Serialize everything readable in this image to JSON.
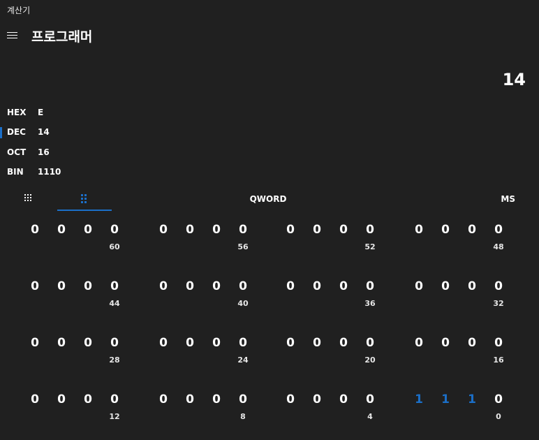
{
  "window": {
    "title": "계산기"
  },
  "header": {
    "menu_icon": "hamburger-icon",
    "mode_title": "프로그래머"
  },
  "display": {
    "value": "14"
  },
  "radix": [
    {
      "name": "HEX",
      "value": "E",
      "active": false
    },
    {
      "name": "DEC",
      "value": "14",
      "active": true
    },
    {
      "name": "OCT",
      "value": "16",
      "active": false
    },
    {
      "name": "BIN",
      "value": "1110",
      "active": false
    }
  ],
  "toolbar": {
    "keypad_icon": "keypad-grid-icon",
    "bit_toggle_icon": "bit-toggle-icon",
    "word_size": "QWORD",
    "memory": "MS"
  },
  "bitpad": {
    "rows": [
      {
        "bits": [
          "0",
          "0",
          "0",
          "0",
          "0",
          "0",
          "0",
          "0",
          "0",
          "0",
          "0",
          "0",
          "0",
          "0",
          "0",
          "0"
        ],
        "labels": [
          "60",
          "56",
          "52",
          "48"
        ]
      },
      {
        "bits": [
          "0",
          "0",
          "0",
          "0",
          "0",
          "0",
          "0",
          "0",
          "0",
          "0",
          "0",
          "0",
          "0",
          "0",
          "0",
          "0"
        ],
        "labels": [
          "44",
          "40",
          "36",
          "32"
        ]
      },
      {
        "bits": [
          "0",
          "0",
          "0",
          "0",
          "0",
          "0",
          "0",
          "0",
          "0",
          "0",
          "0",
          "0",
          "0",
          "0",
          "0",
          "0"
        ],
        "labels": [
          "28",
          "24",
          "20",
          "16"
        ]
      },
      {
        "bits": [
          "0",
          "0",
          "0",
          "0",
          "0",
          "0",
          "0",
          "0",
          "0",
          "0",
          "0",
          "0",
          "1",
          "1",
          "1",
          "0"
        ],
        "labels": [
          "12",
          "8",
          "4",
          "0"
        ]
      }
    ]
  },
  "colors": {
    "background": "#202020",
    "accent": "#1b6fc8",
    "text": "#ffffff"
  }
}
